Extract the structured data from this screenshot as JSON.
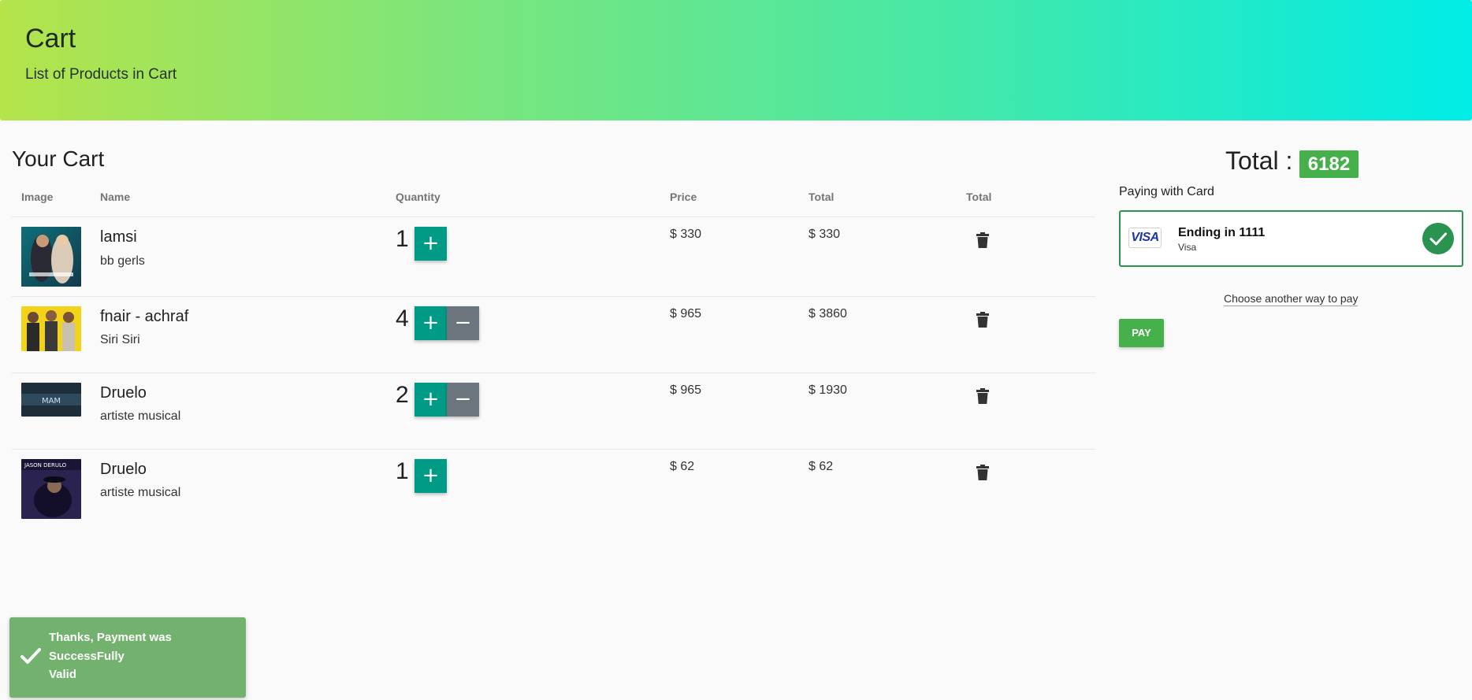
{
  "header": {
    "title": "Cart",
    "subtitle": "List of Products in Cart"
  },
  "cart": {
    "title": "Your Cart",
    "columns": [
      "Image",
      "Name",
      "Quantity",
      "Price",
      "Total",
      "Total"
    ],
    "currency": "$",
    "items": [
      {
        "name": "lamsi",
        "artist": "bb gerls",
        "quantity": "1",
        "price": "$ 330",
        "total": "$ 330",
        "show_minus": false
      },
      {
        "name": "fnair - achraf",
        "artist": "Siri Siri",
        "quantity": "4",
        "price": "$ 965",
        "total": "$ 3860",
        "show_minus": true
      },
      {
        "name": "Druelo",
        "artist": "artiste musical",
        "quantity": "2",
        "price": "$ 965",
        "total": "$ 1930",
        "show_minus": true
      },
      {
        "name": "Druelo",
        "artist": "artiste musical",
        "quantity": "1",
        "price": "$ 62",
        "total": "$ 62",
        "show_minus": false
      }
    ],
    "plus_symbol": "+",
    "minus_symbol": "−",
    "delete_icon": "trash-icon"
  },
  "summary": {
    "total_label": "Total :",
    "total_value": "6182",
    "paying_label": "Paying with Card",
    "card": {
      "logo_text": "VISA",
      "ending": "Ending in 1111",
      "brand": "Visa",
      "selected_icon": "check-icon"
    },
    "choose_another": "Choose another way to pay",
    "pay_label": "PAY"
  },
  "toast": {
    "title": "Thanks, Payment was SuccessFully",
    "message": "Valid",
    "icon": "check-icon"
  },
  "colors": {
    "teal_button": "#009b86",
    "gray_button": "#6c757d",
    "green": "#46b04a",
    "card_border": "#2b9350",
    "toast_bg": "#72b16e"
  }
}
